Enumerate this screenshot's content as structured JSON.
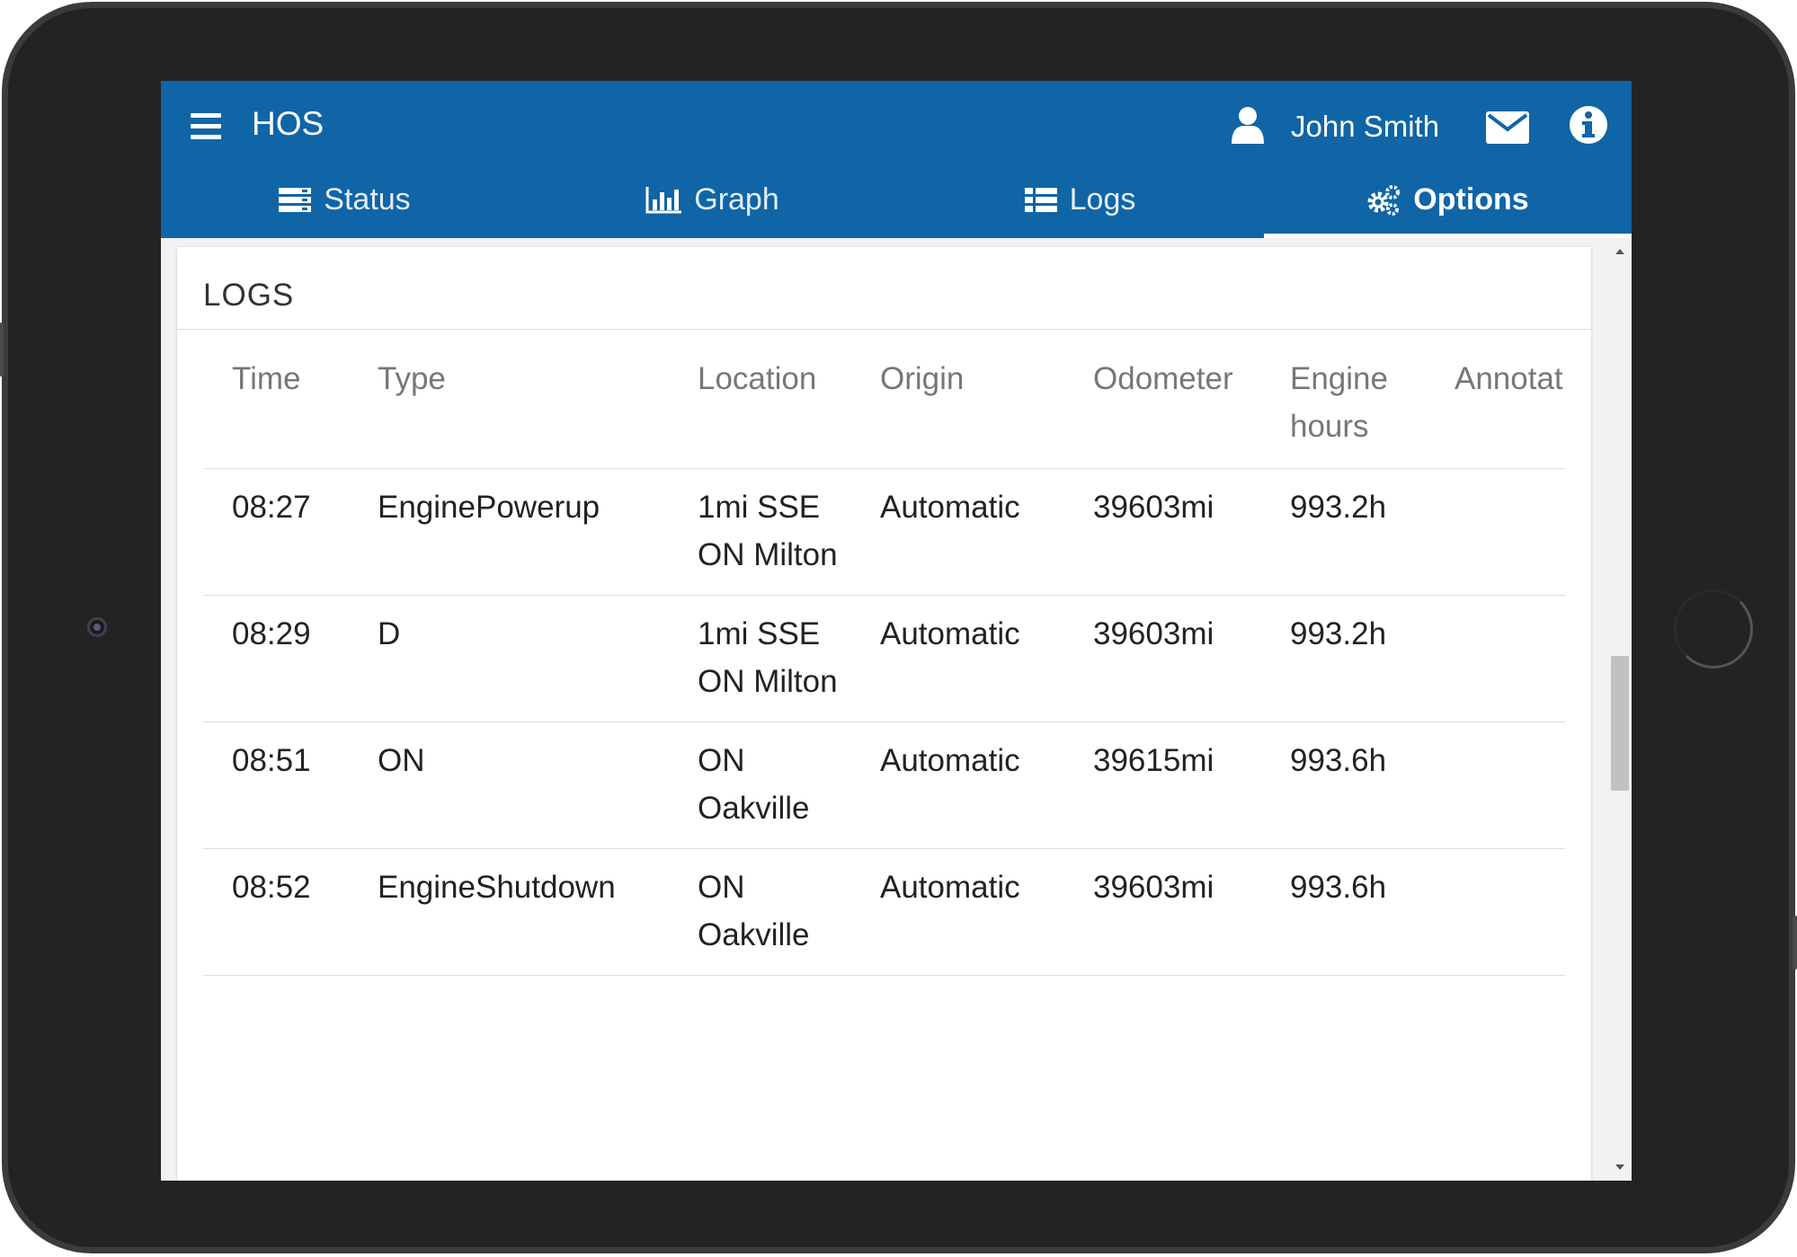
{
  "app": {
    "title": "HOS",
    "user_name": "John Smith"
  },
  "icons": {
    "menu": "hamburger-menu-icon",
    "user": "user-icon",
    "mail": "envelope-icon",
    "info": "info-icon"
  },
  "colors": {
    "appbar": "#1065a6",
    "accent": "#ffffff"
  },
  "tabs": [
    {
      "label": "Status",
      "icon": "server-icon",
      "active": false
    },
    {
      "label": "Graph",
      "icon": "bar-chart-icon",
      "active": false
    },
    {
      "label": "Logs",
      "icon": "list-icon",
      "active": false
    },
    {
      "label": "Options",
      "icon": "cogs-icon",
      "active": true
    }
  ],
  "logs": {
    "title": "LOGS",
    "columns": [
      "Time",
      "Type",
      "Location",
      "Origin",
      "Odometer",
      "Engine hours",
      "Annotations"
    ],
    "rows": [
      {
        "time": "08:27",
        "type": "EnginePowerup",
        "location": "1mi SSE ON Milton",
        "origin": "Automatic",
        "odometer": "39603mi",
        "engine_hours": "993.2h",
        "annotation": ""
      },
      {
        "time": "08:29",
        "type": "D",
        "location": "1mi SSE ON Milton",
        "origin": "Automatic",
        "odometer": "39603mi",
        "engine_hours": "993.2h",
        "annotation": ""
      },
      {
        "time": "08:51",
        "type": "ON",
        "location": "ON Oakville",
        "origin": "Automatic",
        "odometer": "39615mi",
        "engine_hours": "993.6h",
        "annotation": ""
      },
      {
        "time": "08:52",
        "type": "EngineShutdown",
        "location": "ON Oakville",
        "origin": "Automatic",
        "odometer": "39603mi",
        "engine_hours": "993.6h",
        "annotation": ""
      }
    ]
  }
}
